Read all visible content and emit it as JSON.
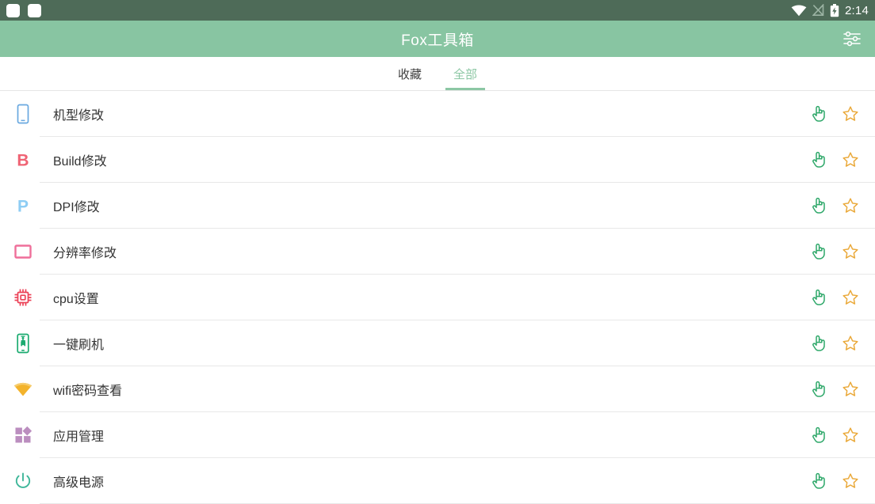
{
  "status_bar": {
    "notification_icons": [
      "notification-square-icon",
      "notification-square-icon"
    ],
    "wifi_icon": "wifi-icon",
    "signal_icon": "signal-off-icon",
    "battery_icon": "battery-charging-icon",
    "time": "2:14",
    "background": "#4e6b58"
  },
  "app_bar": {
    "title": "Fox工具箱",
    "action_icon": "tune-sliders-icon",
    "background": "#88c5a2"
  },
  "tabs": [
    {
      "label": "收藏",
      "active": false
    },
    {
      "label": "全部",
      "active": true
    }
  ],
  "tab_accent": "#8cc7a4",
  "list": {
    "row_action_icons": {
      "shortcut": "touch-hand-icon",
      "favorite": "star-outline-icon"
    },
    "items": [
      {
        "label": "机型修改",
        "icon": "phone-icon",
        "color": "#6aa9e0"
      },
      {
        "label": "Build修改",
        "icon": "letter-b-icon",
        "color": "#ef6374"
      },
      {
        "label": "DPI修改",
        "icon": "letter-p-icon",
        "color": "#8ecdf4"
      },
      {
        "label": "分辨率修改",
        "icon": "resolution-frame-icon",
        "color": "#ef6f9a"
      },
      {
        "label": "cpu设置",
        "icon": "cpu-chip-icon",
        "color": "#ec4257"
      },
      {
        "label": "一键刷机",
        "icon": "flash-phone-icon",
        "color": "#1bab70"
      },
      {
        "label": "wifi密码查看",
        "icon": "wifi-cone-icon",
        "color": "#f3b32c"
      },
      {
        "label": "应用管理",
        "icon": "app-grid-icon",
        "color": "#bb8ebf"
      },
      {
        "label": "高级电源",
        "icon": "power-icon",
        "color": "#3fb79a"
      }
    ]
  }
}
